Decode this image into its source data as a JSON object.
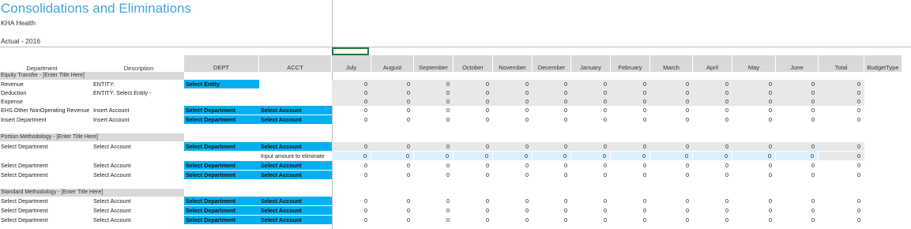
{
  "report": {
    "title": "Consolidations and Eliminations",
    "company": "KHA Health",
    "scenario": "Actual - 2016"
  },
  "columns": {
    "department": "Department",
    "description": "Description",
    "dept": "DEPT",
    "acct": "ACCT",
    "months": [
      "July",
      "August",
      "September",
      "October",
      "November",
      "December",
      "January",
      "February",
      "March",
      "April",
      "May",
      "June"
    ],
    "total": "Total",
    "budget_type": "BudgetType"
  },
  "sections": [
    {
      "title": "Equity Transfer - [Enter Title Here]",
      "rows": [
        {
          "department": "Revenue",
          "description": "ENTITY:",
          "dept": "Select Entity",
          "acct": "",
          "note": "",
          "values": [
            "0",
            "0",
            "0",
            "0",
            "0",
            "0",
            "0",
            "0",
            "0",
            "0",
            "0",
            "0"
          ],
          "total": "0",
          "style": "gray"
        },
        {
          "department": "Deduction",
          "description": "ENTITY: Select Entity -",
          "dept": "",
          "acct": "",
          "note": "",
          "values": [
            "0",
            "0",
            "0",
            "0",
            "0",
            "0",
            "0",
            "0",
            "0",
            "0",
            "0",
            "0"
          ],
          "total": "0",
          "style": "gray"
        },
        {
          "department": "Expense",
          "description": "",
          "dept": "",
          "acct": "",
          "note": "",
          "values": [
            "0",
            "0",
            "0",
            "0",
            "0",
            "0",
            "0",
            "0",
            "0",
            "0",
            "0",
            "0"
          ],
          "total": "0",
          "style": "gray"
        },
        {
          "department": "EHS.Other NonOperating Revenue",
          "description": "Insert Account",
          "dept": "Select Department",
          "acct": "Select Account",
          "note": "",
          "values": [
            "0",
            "0",
            "0",
            "0",
            "0",
            "0",
            "0",
            "0",
            "0",
            "0",
            "0",
            "0"
          ],
          "total": "0",
          "style": "white"
        },
        {
          "department": "Insert Department",
          "description": "Insert Account",
          "dept": "Select Department",
          "acct": "Select Account",
          "note": "",
          "values": [
            "0",
            "0",
            "0",
            "0",
            "0",
            "0",
            "0",
            "0",
            "0",
            "0",
            "0",
            "0"
          ],
          "total": "0",
          "style": "white"
        }
      ]
    },
    {
      "title": "Portion Methodology - [Enter Title Here]",
      "rows": [
        {
          "department": "Select Department",
          "description": "Select Account",
          "dept": "Select Department",
          "acct": "Select Account",
          "note": "",
          "values": [
            "0",
            "0",
            "0",
            "0",
            "0",
            "0",
            "0",
            "0",
            "0",
            "0",
            "0",
            "0"
          ],
          "total": "0",
          "style": "gray"
        },
        {
          "department": "",
          "description": "",
          "dept": "",
          "acct": "",
          "note": "Input amount to eliminate",
          "values": [
            "0",
            "0",
            "0",
            "0",
            "0",
            "0",
            "0",
            "0",
            "0",
            "0",
            "0",
            "0"
          ],
          "total": "0",
          "style": "input"
        },
        {
          "department": "Select Department",
          "description": "Select Account",
          "dept": "Select Department",
          "acct": "Select Account",
          "note": "",
          "values": [
            "0",
            "0",
            "0",
            "0",
            "0",
            "0",
            "0",
            "0",
            "0",
            "0",
            "0",
            "0"
          ],
          "total": "0",
          "style": "white"
        },
        {
          "department": "Select Department",
          "description": "Select Account",
          "dept": "Select Department",
          "acct": "Select Account",
          "note": "",
          "values": [
            "0",
            "0",
            "0",
            "0",
            "0",
            "0",
            "0",
            "0",
            "0",
            "0",
            "0",
            "0"
          ],
          "total": "0",
          "style": "white"
        }
      ]
    },
    {
      "title": "Standard Methodology - [Enter Title Here]",
      "rows": [
        {
          "department": "Select Department",
          "description": "Select Account",
          "dept": "Select Department",
          "acct": "Select Account",
          "note": "",
          "values": [
            "0",
            "0",
            "0",
            "0",
            "0",
            "0",
            "0",
            "0",
            "0",
            "0",
            "0",
            "0"
          ],
          "total": "0",
          "style": "white"
        },
        {
          "department": "Select Department",
          "description": "Select Account",
          "dept": "Select Department",
          "acct": "Select Account",
          "note": "",
          "values": [
            "0",
            "0",
            "0",
            "0",
            "0",
            "0",
            "0",
            "0",
            "0",
            "0",
            "0",
            "0"
          ],
          "total": "0",
          "style": "white"
        },
        {
          "department": "Select Department",
          "description": "Select Account",
          "dept": "Select Department",
          "acct": "Select Account",
          "note": "",
          "values": [
            "0",
            "0",
            "0",
            "0",
            "0",
            "0",
            "0",
            "0",
            "0",
            "0",
            "0",
            "0"
          ],
          "total": "0",
          "style": "white"
        }
      ]
    }
  ]
}
